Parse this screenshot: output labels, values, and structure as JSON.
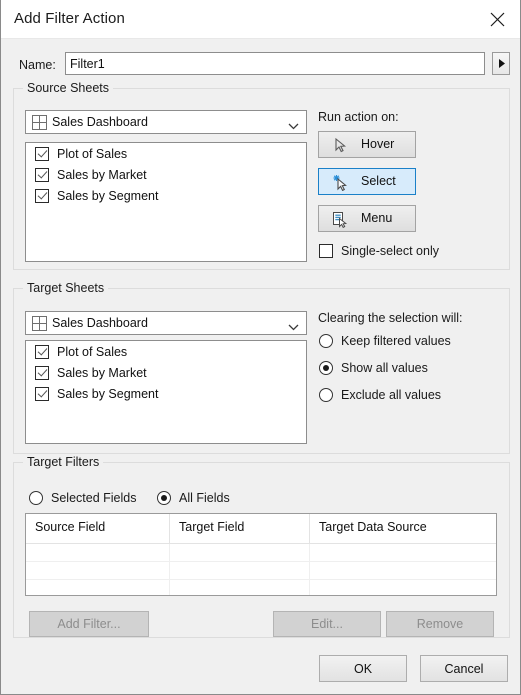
{
  "window": {
    "title": "Add Filter Action",
    "close_icon": "close-icon"
  },
  "name_row": {
    "label": "Name:",
    "value": "Filter1",
    "placeholder": "",
    "arrow_icon": "triangle-right-icon"
  },
  "source_sheets": {
    "title": "Source Sheets",
    "dropdown": {
      "value": "Sales Dashboard",
      "icon": "dashboard-grid-icon",
      "chevron": "chevron-down-icon"
    },
    "sheets": [
      {
        "label": "Plot of Sales",
        "checked": true
      },
      {
        "label": "Sales by Market",
        "checked": true
      },
      {
        "label": "Sales by Segment",
        "checked": true
      }
    ],
    "run_action_label": "Run action on:",
    "actions": [
      {
        "label": "Hover",
        "icon": "cursor-arrow-icon",
        "selected": false
      },
      {
        "label": "Select",
        "icon": "cursor-arrow-sparkle-icon",
        "selected": true
      },
      {
        "label": "Menu",
        "icon": "cursor-menu-icon",
        "selected": false
      }
    ],
    "single_select": {
      "label": "Single-select only",
      "checked": false
    }
  },
  "target_sheets": {
    "title": "Target Sheets",
    "dropdown": {
      "value": "Sales Dashboard",
      "icon": "dashboard-grid-icon",
      "chevron": "chevron-down-icon"
    },
    "sheets": [
      {
        "label": "Plot of Sales",
        "checked": true
      },
      {
        "label": "Sales by Market",
        "checked": true
      },
      {
        "label": "Sales by Segment",
        "checked": true
      }
    ],
    "clearing_label": "Clearing the selection will:",
    "clearing_options": [
      {
        "label": "Keep filtered values",
        "selected": false
      },
      {
        "label": "Show all values",
        "selected": true
      },
      {
        "label": "Exclude all values",
        "selected": false
      }
    ]
  },
  "target_filters": {
    "title": "Target Filters",
    "scope_options": [
      {
        "label": "Selected Fields",
        "selected": false
      },
      {
        "label": "All Fields",
        "selected": true
      }
    ],
    "table": {
      "columns": [
        "Source Field",
        "Target Field",
        "Target Data Source"
      ],
      "rows": [
        [],
        [],
        []
      ]
    },
    "buttons": [
      {
        "label": "Add Filter...",
        "enabled": false
      },
      {
        "label": "Edit...",
        "enabled": false
      },
      {
        "label": "Remove",
        "enabled": false
      }
    ]
  },
  "footer": {
    "ok": "OK",
    "cancel": "Cancel"
  },
  "colors": {
    "accent": "#1a80c8",
    "selected_fill": "#d7ebfb",
    "dialog_bg": "#f0f0f0",
    "field_bg": "#ffffff",
    "disabled_text": "#8d8d8d"
  }
}
